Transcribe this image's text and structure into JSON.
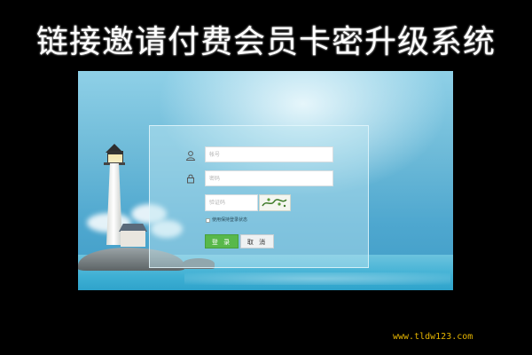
{
  "title": "链接邀请付费会员卡密升级系统",
  "login": {
    "username_placeholder": "帐号",
    "password_placeholder": "密码",
    "captcha_placeholder": "验证码",
    "remember_label": "使用保持登录状态",
    "login_button": "登 录",
    "cancel_button": "取 消"
  },
  "icons": {
    "username": "user-icon",
    "password": "lock-icon",
    "captcha": "captcha-image"
  },
  "colors": {
    "login_button": "#58b84a",
    "background": "#000000",
    "watermark": "#e5b400"
  },
  "watermark": "www.tldw123.com"
}
